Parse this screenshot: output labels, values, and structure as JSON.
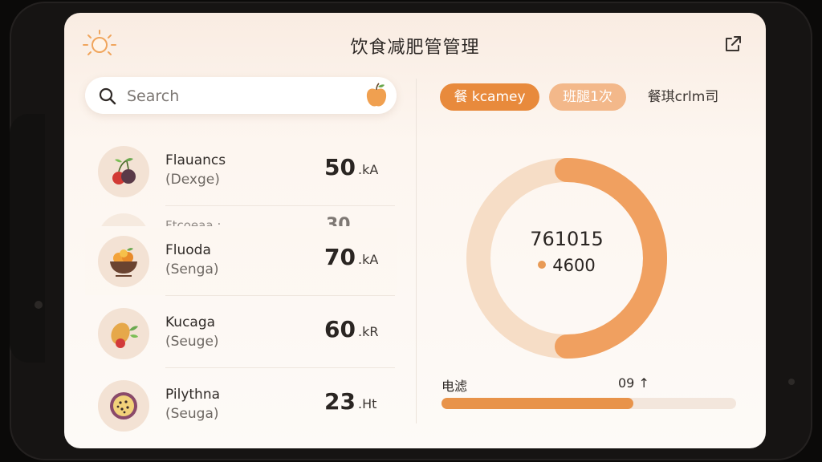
{
  "header": {
    "title": "饮食减肥管管理"
  },
  "search": {
    "placeholder": "Search"
  },
  "food_list": [
    {
      "name": "Flauancs",
      "sub": "(Dexge)",
      "amount": "50",
      "unit": ".kA"
    },
    {
      "name": "Fluoda",
      "sub": "(Senga)",
      "amount": "70",
      "unit": ".kA"
    },
    {
      "name": "Kucaga",
      "sub": "(Seuge)",
      "amount": "60",
      "unit": ".kR"
    },
    {
      "name": "Pilythna",
      "sub": "(Seuga)",
      "amount": "23",
      "unit": ".Ht"
    }
  ],
  "partial_row": {
    "name": "Ftcoeaa :",
    "amount": "30"
  },
  "tabs": [
    {
      "label": "餐 kcamey",
      "active": true
    },
    {
      "label": "班腿1次",
      "active": false
    },
    {
      "label": "餐琪crlm司",
      "active": false
    }
  ],
  "donut": {
    "total": "761015",
    "legend": "4600",
    "fraction": 0.5
  },
  "progress": {
    "label": "电滤",
    "value_text": "09 ↑",
    "fraction": 0.65
  },
  "colors": {
    "accent": "#e88a3c",
    "accent_light": "#f3b88a",
    "donut_main": "#f0a060",
    "donut_light": "#f6d9bf"
  }
}
